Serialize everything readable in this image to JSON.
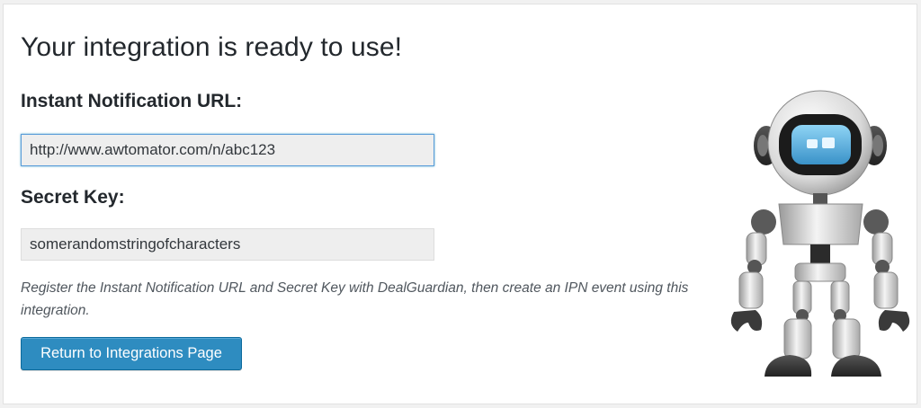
{
  "page": {
    "title": "Your integration is ready to use!"
  },
  "notification_url": {
    "label": "Instant Notification URL:",
    "value": "http://www.awtomator.com/n/abc123"
  },
  "secret_key": {
    "label": "Secret Key:",
    "value": "somerandomstringofcharacters"
  },
  "help_text": "Register the Instant Notification URL and Secret Key with DealGuardian, then create an IPN event using this integration.",
  "button": {
    "label": "Return to Integrations Page"
  },
  "illustration": {
    "icon": "robot-mascot"
  },
  "colors": {
    "button_bg": "#2e8cc0",
    "focus_border": "#5b9dd9",
    "field_bg": "#eeeeee",
    "robot_visor": "#5cb8e6"
  }
}
